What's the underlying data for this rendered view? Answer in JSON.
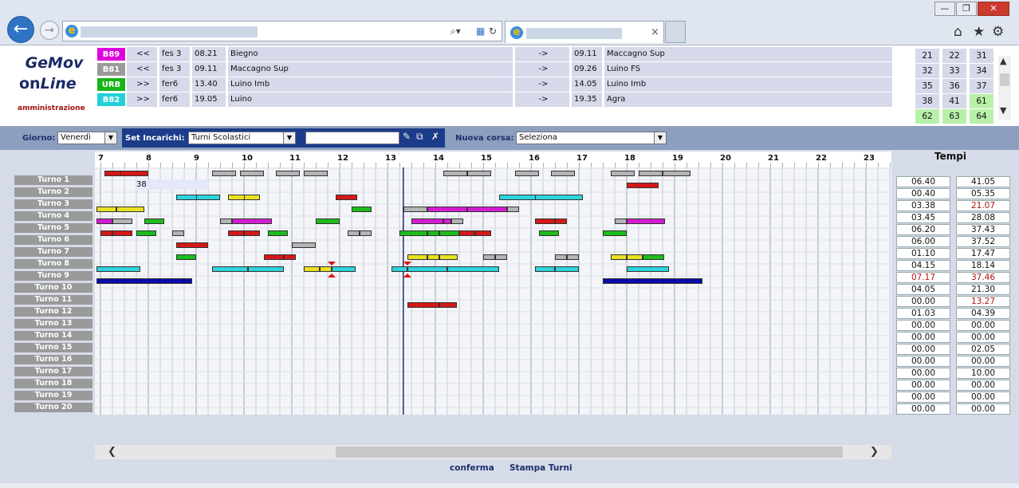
{
  "browser": {
    "window_buttons": [
      "—",
      "❐",
      "✕"
    ],
    "back_label": "←",
    "forward_label": "→",
    "tab_close": "×",
    "ie_glyph": "e"
  },
  "app": {
    "logo_line1": "GeMov",
    "logo_line2_a": "on",
    "logo_line2_b": "Line",
    "subtitle": "amministrazione"
  },
  "trips": [
    {
      "code": "B89",
      "color": "#dd00dd",
      "nav": "<<",
      "day": "fes 3",
      "dep_time": "08.21",
      "dep_place": "Biegno",
      "arrow": "->",
      "arr_time": "09.11",
      "arr_place": "Maccagno Sup"
    },
    {
      "code": "B81",
      "color": "#9a9a9a",
      "nav": "<<",
      "day": "fes 3",
      "dep_time": "09.11",
      "dep_place": "Maccagno Sup",
      "arrow": "->",
      "arr_time": "09.26",
      "arr_place": "Luino FS"
    },
    {
      "code": "URB",
      "color": "#18b418",
      "nav": ">>",
      "day": "fer6",
      "dep_time": "13.40",
      "dep_place": "Luino Imb",
      "arrow": "->",
      "arr_time": "14.05",
      "arr_place": "Luino Imb"
    },
    {
      "code": "B82",
      "color": "#22d0d8",
      "nav": ">>",
      "day": "fer6",
      "dep_time": "19.05",
      "dep_place": "Luino",
      "arrow": "->",
      "arr_time": "19.35",
      "arr_place": "Agra"
    }
  ],
  "number_grid": [
    [
      "21",
      "22",
      "31"
    ],
    [
      "32",
      "33",
      "34"
    ],
    [
      "35",
      "36",
      "37"
    ],
    [
      "38",
      "41",
      "61"
    ],
    [
      "62",
      "63",
      "64"
    ]
  ],
  "toolbar": {
    "giorno_label": "Giorno:",
    "giorno_value": "Venerdì",
    "set_label": "Set Incarichi:",
    "set_value": "Turni Scolastici",
    "nuova_label": "Nuova corsa:",
    "nuova_value": "Seleziona"
  },
  "hours": [
    "7",
    "8",
    "9",
    "10",
    "11",
    "12",
    "13",
    "14",
    "15",
    "16",
    "17",
    "18",
    "19",
    "20",
    "21",
    "22",
    "23"
  ],
  "turni": [
    "Turno 1",
    "Turno 2",
    "Turno 3",
    "Turno 4",
    "Turno 5",
    "Turno 6",
    "Turno 7",
    "Turno 8",
    "Turno 9",
    "Turno 10",
    "Turno 11",
    "Turno 12",
    "Turno 13",
    "Turno 14",
    "Turno 15",
    "Turno 16",
    "Turno 17",
    "Turno 18",
    "Turno 19",
    "Turno 20"
  ],
  "turno2_marker": "38",
  "tempi_title": "Tempi",
  "tempi": [
    [
      "06.40",
      "41.05"
    ],
    [
      "00.40",
      "05.35"
    ],
    [
      "03.38",
      "21.07"
    ],
    [
      "03.45",
      "28.08"
    ],
    [
      "06.20",
      "37.43"
    ],
    [
      "06.00",
      "37.52"
    ],
    [
      "01.10",
      "17.47"
    ],
    [
      "04.15",
      "18.14"
    ],
    [
      "07.17",
      "37.46"
    ],
    [
      "04.05",
      "21.30"
    ],
    [
      "00.00",
      "13.27"
    ],
    [
      "01.03",
      "04.39"
    ],
    [
      "00.00",
      "00.00"
    ],
    [
      "00.00",
      "00.00"
    ],
    [
      "00.00",
      "02.05"
    ],
    [
      "00.00",
      "00.00"
    ],
    [
      "00.00",
      "10.00"
    ],
    [
      "00.00",
      "00.00"
    ],
    [
      "00.00",
      "00.00"
    ],
    [
      "00.00",
      "00.00"
    ]
  ],
  "tempi_red": [
    [
      2,
      1
    ],
    [
      8,
      0
    ],
    [
      8,
      1
    ],
    [
      10,
      1
    ]
  ],
  "colors": {
    "red": "#d41818",
    "grey": "#b4b4b4",
    "cyan": "#2ed3dc",
    "yellow": "#e8e020",
    "green": "#1cbc1c",
    "magenta": "#d41cd4",
    "navy": "#0a0aa8"
  },
  "shifts": [
    [
      [
        "red",
        7.08,
        7.5
      ],
      [
        "red",
        7.42,
        8.0
      ],
      [
        "grey",
        9.33,
        9.83
      ],
      [
        "grey",
        9.92,
        10.42
      ],
      [
        "grey",
        10.67,
        11.17
      ],
      [
        "grey",
        11.25,
        11.75
      ],
      [
        "grey",
        14.17,
        14.67
      ],
      [
        "grey",
        14.67,
        15.17
      ],
      [
        "grey",
        15.67,
        16.17
      ],
      [
        "grey",
        16.42,
        16.92
      ],
      [
        "grey",
        17.67,
        18.17
      ],
      [
        "grey",
        18.25,
        18.75
      ],
      [
        "grey",
        18.75,
        19.33
      ]
    ],
    [
      [
        "red",
        18.0,
        18.67
      ]
    ],
    [
      [
        "cyan",
        8.58,
        9.08
      ],
      [
        "cyan",
        9.0,
        9.5
      ],
      [
        "yellow",
        9.67,
        10.08
      ],
      [
        "yellow",
        10.0,
        10.33
      ],
      [
        "red",
        11.92,
        12.37
      ],
      [
        "cyan",
        15.33,
        16.33
      ],
      [
        "cyan",
        16.08,
        17.08
      ]
    ],
    [
      [
        "yellow",
        6.92,
        7.33
      ],
      [
        "yellow",
        7.33,
        7.92
      ],
      [
        "green",
        12.25,
        12.67
      ],
      [
        "grey",
        13.33,
        13.83
      ],
      [
        "magenta",
        13.83,
        14.67
      ],
      [
        "magenta",
        14.67,
        15.5
      ],
      [
        "grey",
        15.5,
        15.75
      ]
    ],
    [
      [
        "magenta",
        6.92,
        7.25
      ],
      [
        "grey",
        7.25,
        7.67
      ],
      [
        "green",
        7.92,
        8.33
      ],
      [
        "grey",
        9.5,
        9.75
      ],
      [
        "magenta",
        9.75,
        10.58
      ],
      [
        "green",
        11.5,
        12.0
      ],
      [
        "magenta",
        13.5,
        14.17
      ],
      [
        "magenta",
        14.17,
        14.33
      ],
      [
        "grey",
        14.33,
        14.58
      ],
      [
        "red",
        16.08,
        16.5
      ],
      [
        "red",
        16.5,
        16.75
      ],
      [
        "grey",
        17.75,
        18.0
      ],
      [
        "magenta",
        18.0,
        18.8
      ]
    ],
    [
      [
        "red",
        7.0,
        7.25
      ],
      [
        "red",
        7.25,
        7.67
      ],
      [
        "green",
        7.75,
        8.17
      ],
      [
        "grey",
        8.5,
        8.75
      ],
      [
        "red",
        9.67,
        10.0
      ],
      [
        "red",
        10.0,
        10.33
      ],
      [
        "green",
        10.5,
        10.92
      ],
      [
        "grey",
        12.17,
        12.42
      ],
      [
        "grey",
        12.42,
        12.67
      ],
      [
        "green",
        13.25,
        13.83
      ],
      [
        "green",
        13.83,
        14.08
      ],
      [
        "green",
        14.08,
        14.5
      ],
      [
        "red",
        14.5,
        14.83
      ],
      [
        "red",
        14.83,
        15.17
      ],
      [
        "green",
        16.17,
        16.58
      ],
      [
        "green",
        17.5,
        18.0
      ]
    ],
    [
      [
        "red",
        8.58,
        9.25
      ],
      [
        "grey",
        11.0,
        11.5
      ]
    ],
    [
      [
        "green",
        8.58,
        9.0
      ],
      [
        "red",
        10.42,
        10.83
      ],
      [
        "red",
        10.83,
        11.08
      ],
      [
        "yellow",
        13.42,
        13.83
      ],
      [
        "yellow",
        13.83,
        14.08
      ],
      [
        "yellow",
        14.08,
        14.47
      ],
      [
        "grey",
        15.0,
        15.25
      ],
      [
        "grey",
        15.25,
        15.5
      ],
      [
        "grey",
        16.5,
        16.75
      ],
      [
        "grey",
        16.75,
        17.0
      ],
      [
        "yellow",
        17.67,
        18.0
      ],
      [
        "yellow",
        18.0,
        18.33
      ],
      [
        "green",
        18.33,
        18.78
      ]
    ],
    [
      [
        "cyan",
        6.92,
        7.83
      ],
      [
        "cyan",
        9.33,
        10.08
      ],
      [
        "cyan",
        10.08,
        10.83
      ],
      [
        "yellow",
        11.25,
        11.58
      ],
      [
        "yellow",
        11.58,
        11.83
      ],
      [
        "cyan",
        11.83,
        12.33
      ],
      [
        "cyan",
        13.08,
        13.42
      ],
      [
        "cyan",
        13.42,
        14.25
      ],
      [
        "cyan",
        14.25,
        15.33
      ],
      [
        "cyan",
        16.08,
        16.5
      ],
      [
        "cyan",
        16.5,
        17.0
      ],
      [
        "cyan",
        18.0,
        18.88
      ]
    ],
    [
      [
        "navy",
        6.92,
        8.92
      ],
      [
        "navy",
        17.5,
        19.58
      ]
    ],
    [],
    [
      [
        "red",
        13.42,
        14.08
      ],
      [
        "red",
        14.08,
        14.45
      ]
    ],
    [],
    [],
    [],
    [],
    [],
    [],
    [],
    []
  ],
  "footer": {
    "confirm": "conferma",
    "print": "Stampa Turni"
  }
}
